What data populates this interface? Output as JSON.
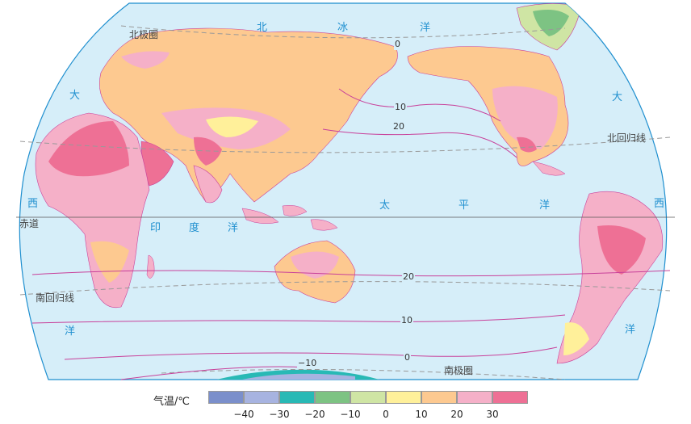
{
  "labels": {
    "north_polar_circle": "北极圈",
    "south_polar_circle": "南极圈",
    "tropic_cancer": "北回归线",
    "tropic_capricorn": "南回归线",
    "equator": "赤道",
    "arctic": [
      "北",
      "冰",
      "洋"
    ],
    "pacific": [
      "太",
      "平",
      "洋"
    ],
    "indian": [
      "印",
      "度",
      "洋"
    ],
    "atlantic_left_n": "大",
    "atlantic_left_w": "西",
    "atlantic_left_s": "洋",
    "atlantic_right_n": "大",
    "atlantic_right_w": "西",
    "atlantic_right_s": "洋"
  },
  "isotherms": {
    "arctic_0": "0",
    "pacific_n_10": "10",
    "pacific_n_20": "20",
    "pacific_s_20": "20",
    "pacific_s_10": "10",
    "pacific_s_0": "0",
    "antarctic_m10": "−10"
  },
  "legend": {
    "title": "气温/℃",
    "swatches": [
      "#7b8fcb",
      "#a7b3e0",
      "#28b9b5",
      "#7dc383",
      "#cfe5a4",
      "#fff09a",
      "#fdc990",
      "#f5b0c8",
      "#ee7095"
    ],
    "ticks": [
      "−40",
      "−30",
      "−20",
      "−10",
      "0",
      "10",
      "20",
      "30"
    ]
  },
  "colors": {
    "ocean": "#d6eef9",
    "isotherm_line": "#c8409a",
    "land_warm": "#f5b0c8",
    "land_mild": "#fdc990",
    "land_hot": "#ee7095",
    "land_cool": "#fff09a",
    "river": "#3ba3d6"
  }
}
